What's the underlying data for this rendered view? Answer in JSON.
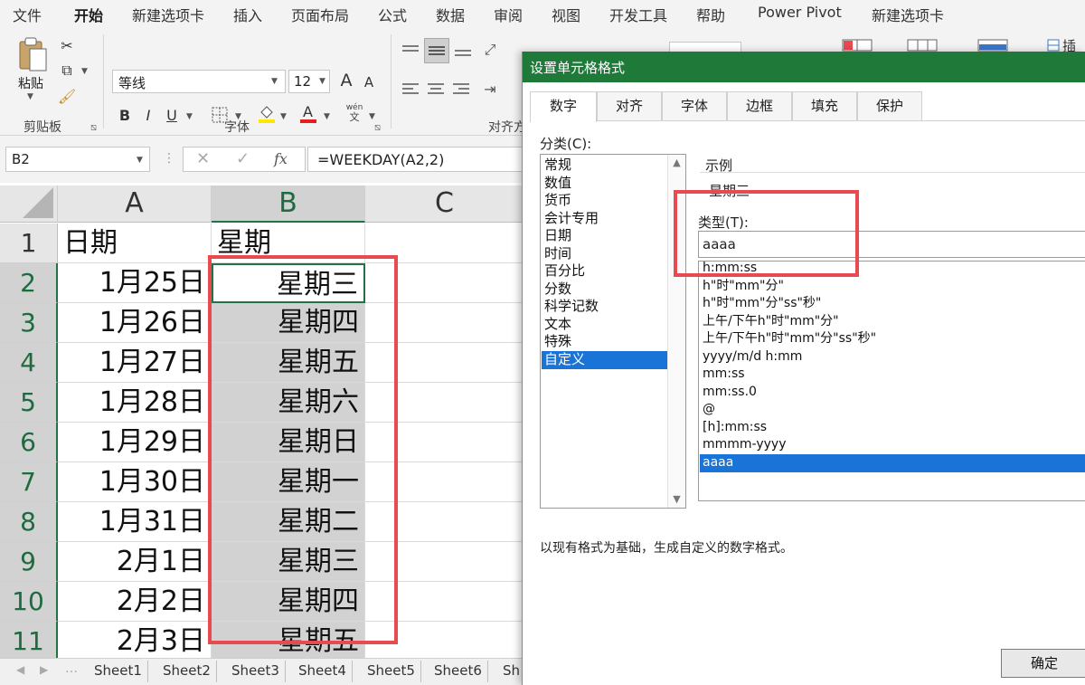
{
  "ribbon": {
    "tabs": [
      "文件",
      "开始",
      "新建选项卡",
      "插入",
      "页面布局",
      "公式",
      "数据",
      "审阅",
      "视图",
      "开发工具",
      "帮助",
      "Power Pivot",
      "新建选项卡"
    ],
    "paste_label": "粘贴",
    "clipboard_group": "剪贴板",
    "font_group": "字体",
    "align_group": "对齐方",
    "font_name": "等线",
    "font_size": "12",
    "bold": "B",
    "italic": "I",
    "underline": "U",
    "phonetic": "wén",
    "phonetic_sub": "文",
    "grow_font": "A",
    "shrink_font": "A"
  },
  "formula_bar": {
    "name_box": "B2",
    "formula": "=WEEKDAY(A2,2)",
    "fx": "fx"
  },
  "grid": {
    "columns": [
      "A",
      "B",
      "C"
    ],
    "rows": [
      {
        "n": "1",
        "a": "日期",
        "b": "星期"
      },
      {
        "n": "2",
        "a": "1月25日",
        "b": "星期三"
      },
      {
        "n": "3",
        "a": "1月26日",
        "b": "星期四"
      },
      {
        "n": "4",
        "a": "1月27日",
        "b": "星期五"
      },
      {
        "n": "5",
        "a": "1月28日",
        "b": "星期六"
      },
      {
        "n": "6",
        "a": "1月29日",
        "b": "星期日"
      },
      {
        "n": "7",
        "a": "1月30日",
        "b": "星期一"
      },
      {
        "n": "8",
        "a": "1月31日",
        "b": "星期二"
      },
      {
        "n": "9",
        "a": "2月1日",
        "b": "星期三"
      },
      {
        "n": "10",
        "a": "2月2日",
        "b": "星期四"
      },
      {
        "n": "11",
        "a": "2月3日",
        "b": "星期五"
      }
    ]
  },
  "sheets": [
    "Sheet1",
    "Sheet2",
    "Sheet3",
    "Sheet4",
    "Sheet5",
    "Sheet6",
    "Sh"
  ],
  "dialog": {
    "title": "设置单元格格式",
    "tabs": [
      "数字",
      "对齐",
      "字体",
      "边框",
      "填充",
      "保护"
    ],
    "category_label": "分类(C):",
    "categories": [
      "常规",
      "数值",
      "货币",
      "会计专用",
      "日期",
      "时间",
      "百分比",
      "分数",
      "科学记数",
      "文本",
      "特殊",
      "自定义"
    ],
    "selected_category": "自定义",
    "sample_label": "示例",
    "sample_value": "星期三",
    "type_label": "类型(T):",
    "type_value": "aaaa",
    "type_list": [
      "h:mm:ss",
      "h\"时\"mm\"分\"",
      "h\"时\"mm\"分\"ss\"秒\"",
      "上午/下午h\"时\"mm\"分\"",
      "上午/下午h\"时\"mm\"分\"ss\"秒\"",
      "yyyy/m/d h:mm",
      "mm:ss",
      "mm:ss.0",
      "@",
      "[h]:mm:ss",
      "mmmm-yyyy",
      "aaaa"
    ],
    "selected_type": "aaaa",
    "description": "以现有格式为基础，生成自定义的数字格式。",
    "ok_label": "确定"
  },
  "colors": {
    "excel_green": "#217346",
    "dialog_title_bg": "#1f7a3a",
    "highlight_red": "#e84a4f",
    "selection_blue": "#1a73d6"
  }
}
